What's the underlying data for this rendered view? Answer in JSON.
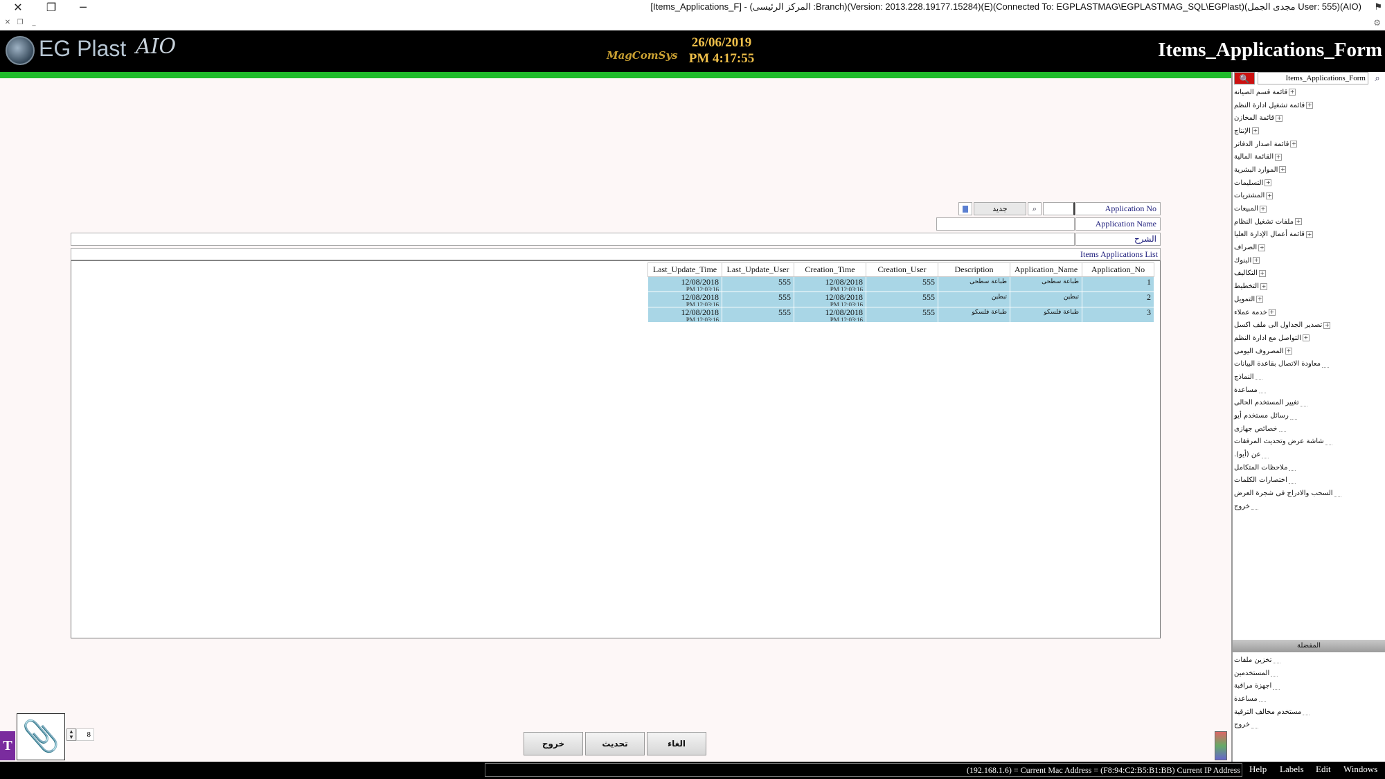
{
  "window": {
    "title": "[Items_Applications_F] - (المركز الرئيسى :Branch)(Version: 2013.228.19177.15284)(E)(Connected To: EGPLASTMAG\\EGPLASTMAG_SQL\\EGPlast)(مجدى الجمل User: 555)(AIO)"
  },
  "header": {
    "logo_text": "EG Plast",
    "logo_suffix": "AIO",
    "vendor_logo": "MagComSys",
    "date": "26/06/2019",
    "time": "PM 4:17:55",
    "form_title": "Items_Applications_Form"
  },
  "colors": {
    "accent_green": "#1fbb2a",
    "grid_row": "#a9d6e6",
    "header_bg": "#000000",
    "date_color": "#f0c04a"
  },
  "sidebar": {
    "search_value": "Items_Applications_Form",
    "tree": [
      {
        "label": "قائمة قسم الصيانة",
        "expandable": true
      },
      {
        "label": "قائمة تشغيل ادارة النظم",
        "expandable": true
      },
      {
        "label": "قائمة المخازن",
        "expandable": true
      },
      {
        "label": "الإنتاج",
        "expandable": true
      },
      {
        "label": "قائمة اصدار الدفاتر",
        "expandable": true
      },
      {
        "label": "القائمة المالية",
        "expandable": true
      },
      {
        "label": "الموارد البشرية",
        "expandable": true
      },
      {
        "label": "التسليمات",
        "expandable": true
      },
      {
        "label": "المشتريات",
        "expandable": true
      },
      {
        "label": "المبيعات",
        "expandable": true
      },
      {
        "label": "ملفات تشغيل النظام",
        "expandable": true
      },
      {
        "label": "قائمة أعمال الإدارة العليا",
        "expandable": true
      },
      {
        "label": "الصراف",
        "expandable": true
      },
      {
        "label": "البنوك",
        "expandable": true
      },
      {
        "label": "التكاليف",
        "expandable": true
      },
      {
        "label": "التخطيط",
        "expandable": true
      },
      {
        "label": "التمويل",
        "expandable": true
      },
      {
        "label": "خدمة عملاء",
        "expandable": true
      },
      {
        "label": "تصدير الجداول الى ملف اكسل",
        "expandable": true
      },
      {
        "label": "التواصل مع ادارة النظم",
        "expandable": true
      },
      {
        "label": "المصروف اليومى",
        "expandable": true
      },
      {
        "label": "معاودة الاتصال بقاعدة البيانات",
        "expandable": false
      },
      {
        "label": "النماذج",
        "expandable": false
      },
      {
        "label": "مساعدة",
        "expandable": false
      },
      {
        "label": "تغيير المستخدم الحالى",
        "expandable": false
      },
      {
        "label": "رسائل مستخدم أيو",
        "expandable": false
      },
      {
        "label": "خصائص جهازى",
        "expandable": false
      },
      {
        "label": "شاشة عرض وتحديث المرفقات",
        "expandable": false
      },
      {
        "label": "عن (أيو).",
        "expandable": false
      },
      {
        "label": "ملاحظات المتكامل",
        "expandable": false
      },
      {
        "label": "اختصارات الكلمات",
        "expandable": false
      },
      {
        "label": "السحب والادراج فى شجرة العرض",
        "expandable": false
      },
      {
        "label": "خروج",
        "expandable": false
      }
    ],
    "bottom_title": "المفضلة",
    "bottom_items": [
      {
        "label": "تخزين ملفات"
      },
      {
        "label": "المستخدمين"
      },
      {
        "label": "اجهزة مراقبة"
      },
      {
        "label": "مساعدة"
      },
      {
        "label": "مستخدم مخالف الترقية"
      },
      {
        "label": "خروج"
      }
    ]
  },
  "form": {
    "application_no_label": "Application No",
    "application_no_value": "",
    "new_button": "جديد",
    "application_name_label": "Application Name",
    "application_name_value": "",
    "description_label": "الشرح",
    "description_value": "",
    "list_title": "Items Applications List"
  },
  "grid": {
    "columns": [
      "Last_Update_Time",
      "Last_Update_User",
      "Creation_Time",
      "Creation_User",
      "Description",
      "Application_Name",
      "Application_No"
    ],
    "rows": [
      {
        "last_update_time": "12/08/2018",
        "last_update_user": "555",
        "creation_time": "12/08/2018",
        "creation_user": "555",
        "description": "طباعة سطحى",
        "application_name": "طباعة سطحى",
        "application_no": "1"
      },
      {
        "last_update_time": "12/08/2018",
        "last_update_user": "555",
        "creation_time": "12/08/2018",
        "creation_user": "555",
        "description": "تبطين",
        "application_name": "تبطين",
        "application_no": "2"
      },
      {
        "last_update_time": "12/08/2018",
        "last_update_user": "555",
        "creation_time": "12/08/2018",
        "creation_user": "555",
        "description": "طباعة فلسكو",
        "application_name": "طباعة فلسكو",
        "application_no": "3"
      }
    ]
  },
  "bottom": {
    "page_value": "8",
    "exit_button": "خروج",
    "refresh_button": "تحديث",
    "cancel_button": "الغاء"
  },
  "statusbar": {
    "info": "(192.168.1.6) = Current Mac Address = (F8:94:C2:B5:B1:BB) Current IP Address",
    "menu": [
      "Help",
      "Labels",
      "Edit",
      "Windows"
    ]
  }
}
